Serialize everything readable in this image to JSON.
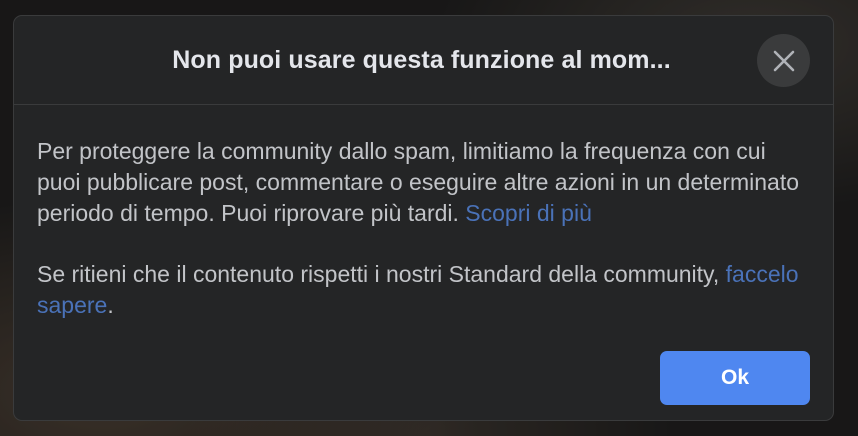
{
  "dialog": {
    "title": "Non puoi usare questa funzione al mom...",
    "close_icon": "close-icon",
    "paragraph1_text": "Per proteggere la community dallo spam, limitiamo la frequenza con cui puoi pubblicare post, commentare o eseguire altre azioni in un determinato periodo di tempo. Puoi riprovare più tardi. ",
    "paragraph1_link": "Scopri di più",
    "paragraph2_text": "Se ritieni che il contenuto rispetti i nostri Standard della community, ",
    "paragraph2_link": "faccelo sapere",
    "paragraph2_end": ".",
    "ok_label": "Ok"
  },
  "colors": {
    "dialog_background": "#242526",
    "text_primary": "#e4e6eb",
    "text_secondary": "#c2c4c8",
    "link": "#4a72b8",
    "primary_button": "#4f87f0"
  }
}
